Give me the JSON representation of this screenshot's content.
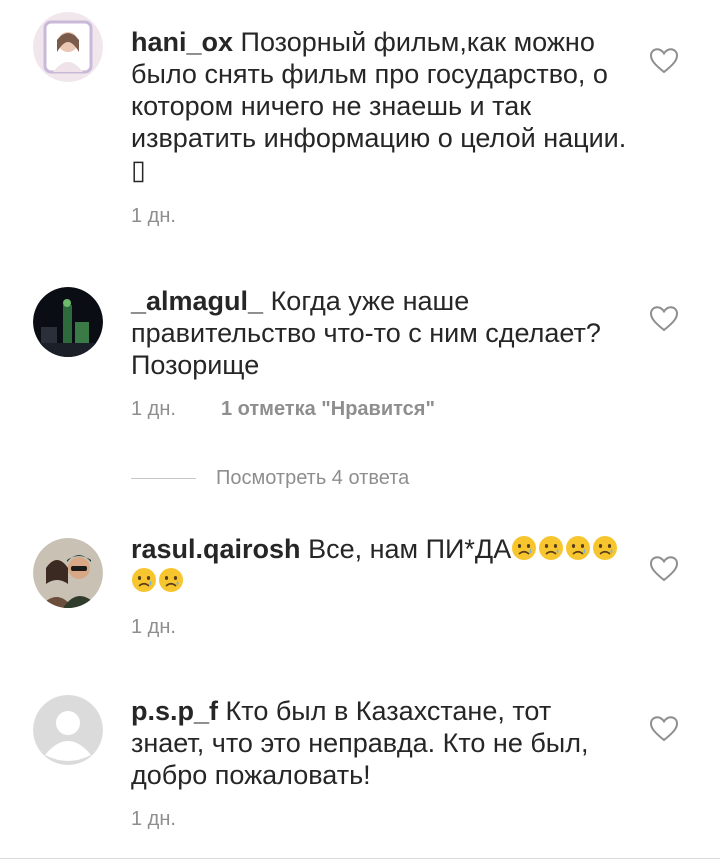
{
  "comments": [
    {
      "username": "hani_ox",
      "text": "Позорный фильм,как можно было снять фильм про государство, о котором ничего не знаешь и так извратить информацию о целой нации. ▯",
      "time": "1 дн."
    },
    {
      "username": "_almagul_",
      "text": "Когда уже наше правительство что-то с ним сделает? Позорище",
      "time": "1 дн.",
      "likes": "1 отметка \"Нравится\""
    },
    {
      "username": "rasul.qairosh",
      "text": "Все, нам ПИ*ДА",
      "emoji": "crying-face",
      "time": "1 дн."
    },
    {
      "username": "p.s.p_f",
      "text": "Кто был в Казахстане, тот знает, что это неправда. Кто не был, добро пожаловать!",
      "time": "1 дн."
    }
  ],
  "replies_label": "Посмотреть 4 ответа",
  "colors": {
    "text": "#262626",
    "secondary": "#8e8e8e",
    "emoji_face": "#f7c52e"
  }
}
